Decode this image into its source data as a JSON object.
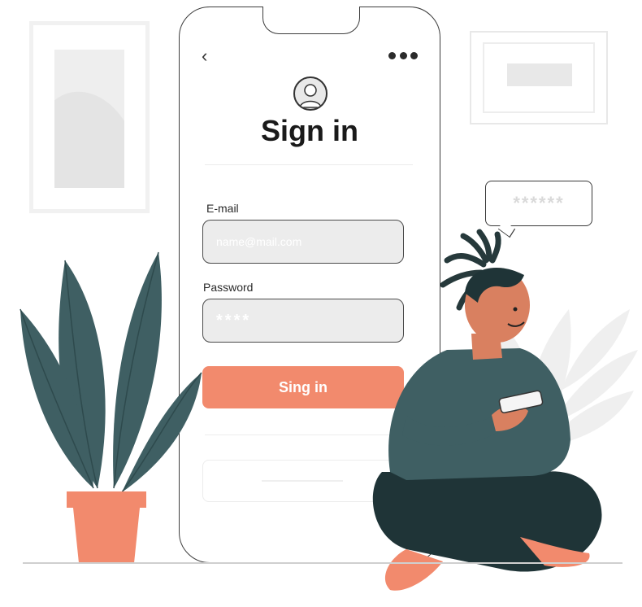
{
  "phone": {
    "title": "Sign in",
    "email_label": "E-mail",
    "email_placeholder": "name@mail.com",
    "password_label": "Password",
    "password_value": "****",
    "submit_label": "Sing in"
  },
  "speech_bubble": {
    "text": "******"
  },
  "icons": {
    "back": "chevron-left-icon",
    "more": "more-dots-icon",
    "avatar": "user-avatar-icon"
  },
  "colors": {
    "accent": "#f28a6d",
    "plant": "#3f5f63",
    "field_bg": "#ececec"
  }
}
